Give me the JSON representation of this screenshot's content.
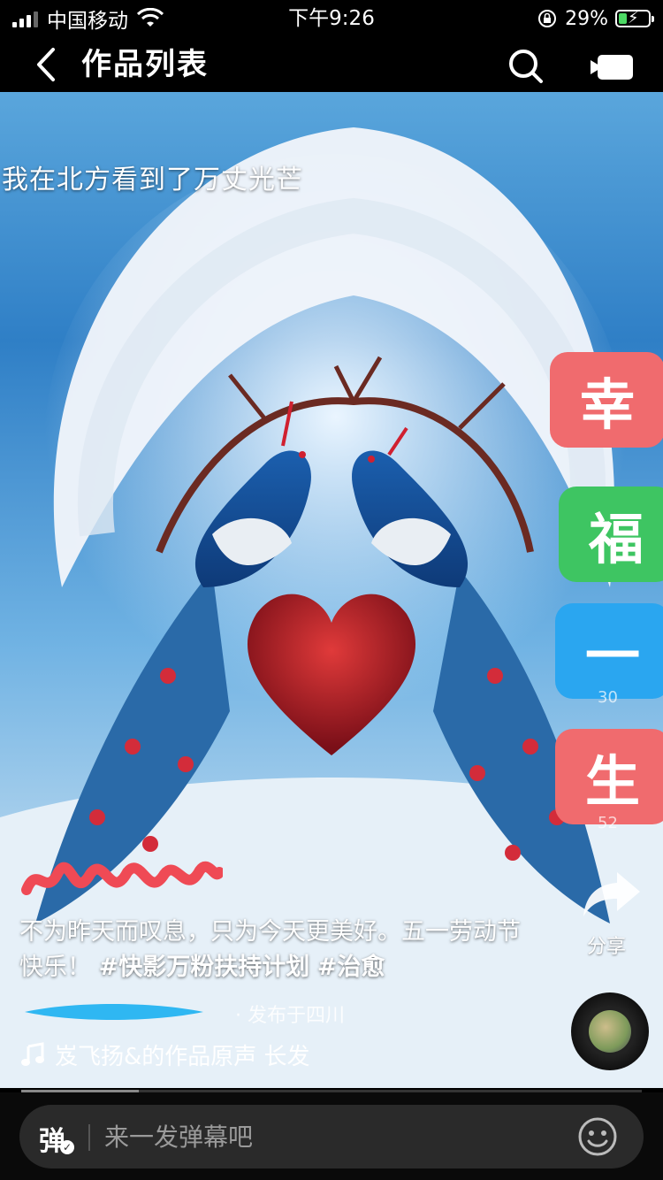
{
  "status_bar": {
    "carrier": "中国移动",
    "time": "下午9:26",
    "battery_percent": "29%",
    "battery_level": 0.29
  },
  "nav": {
    "title": "作品列表",
    "icons": [
      "back-icon",
      "search-icon",
      "camera-icon"
    ]
  },
  "video": {
    "overlay_text": "我在北方看到了万丈光芒",
    "side_buttons": [
      "幸",
      "福",
      "一",
      "生"
    ],
    "ghost_counts": [
      "30",
      "52"
    ],
    "share_label": "分享"
  },
  "post": {
    "description_text": "不为昨天而叹息，只为今天更美好。五一劳动节快乐！",
    "hashtags": [
      "#快影万粉扶持计划",
      "#治愈"
    ],
    "location": "· 发布于四川",
    "music": "岌飞扬&的作品原声    长发"
  },
  "comment_bar": {
    "danmu_label": "弹",
    "placeholder": "来一发弹幕吧"
  },
  "playback": {
    "progress": 0.19
  },
  "colors": {
    "fu_red": "#f06b6e",
    "fu_green": "#3ec562",
    "fu_blue": "#2aa6f0"
  }
}
